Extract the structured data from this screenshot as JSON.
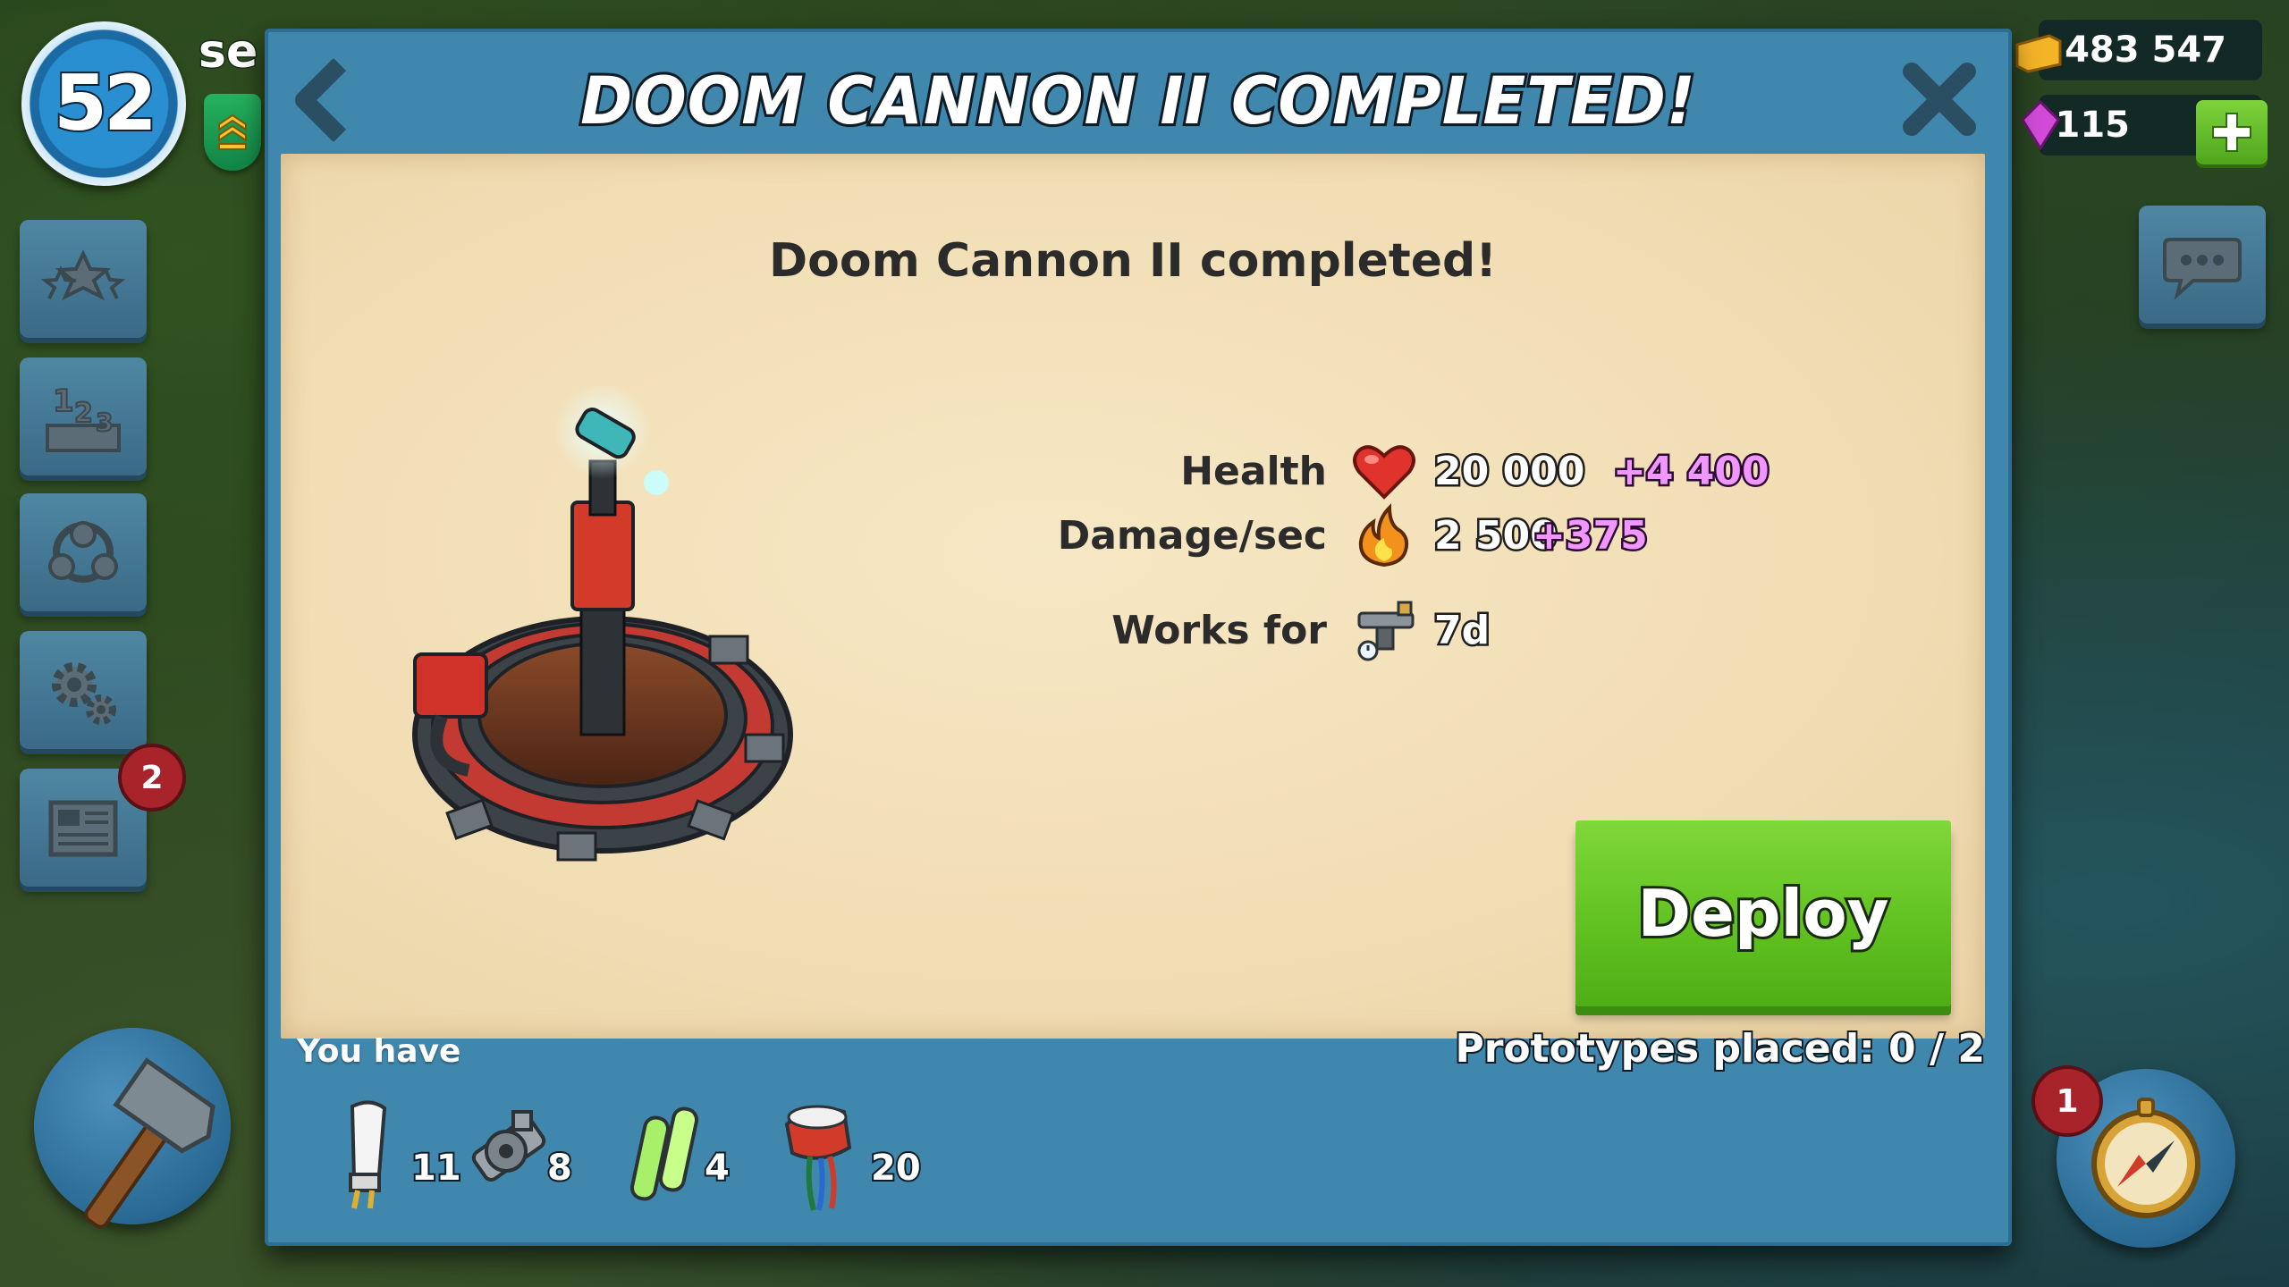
{
  "hud": {
    "level": "52",
    "player_name": "se",
    "gold": "483 547",
    "diamonds": "115",
    "news_badge": "2",
    "map_badge": "1"
  },
  "dialog": {
    "title": "DOOM CANNON II COMPLETED!",
    "subtitle": "Doom Cannon II completed!",
    "stats": [
      {
        "label": "Health",
        "icon": "heart-icon",
        "value": "20 000",
        "bonus": "+4 400"
      },
      {
        "label": "Damage/sec",
        "icon": "fire-icon",
        "value": "2 500",
        "bonus": "+375"
      },
      {
        "label": "Works for",
        "icon": "prototype-timer-icon",
        "value": "7d",
        "bonus": ""
      }
    ],
    "deploy_label": "Deploy",
    "you_have_label": "You have",
    "prototypes_placed": "Prototypes placed: 0 / 2",
    "parts": [
      {
        "name": "fuse-icon",
        "count": "11"
      },
      {
        "name": "gear-icon",
        "count": "8"
      },
      {
        "name": "capacitor-icon",
        "count": "4"
      },
      {
        "name": "wire-icon",
        "count": "20"
      }
    ]
  },
  "colors": {
    "dialog_frame": "#3f87ad",
    "paper": "#f2e0b9",
    "deploy_green": "#5fc01f",
    "bonus_pink": "#f196ff"
  }
}
